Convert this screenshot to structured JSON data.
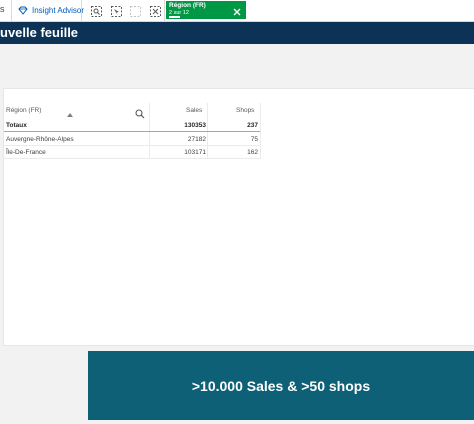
{
  "toolbar": {
    "edge_text": "s",
    "insight_label": "Insight Advisor",
    "tools": [
      "smart-search-icon",
      "selections-tool-icon",
      "clear-selections-icon",
      "clear-all-icon"
    ]
  },
  "selection": {
    "field": "Région (FR)",
    "count": "2 sur 12",
    "color": "#009845"
  },
  "sheet": {
    "title": "uvelle feuille",
    "header_color": "#0c3256"
  },
  "table": {
    "headers": [
      "Région (FR)",
      "Sales",
      "Shops"
    ],
    "totals": {
      "label": "Totaux",
      "sales": "130353",
      "shops": "237"
    },
    "rows": [
      {
        "region": "Auvergne-Rhône-Alpes",
        "sales": "27182",
        "shops": "75"
      },
      {
        "region": "Île-De-France",
        "sales": "103171",
        "shops": "162"
      }
    ]
  },
  "kpi": {
    "text": ">10.000 Sales & >50 shops",
    "color": "#0e6077"
  }
}
